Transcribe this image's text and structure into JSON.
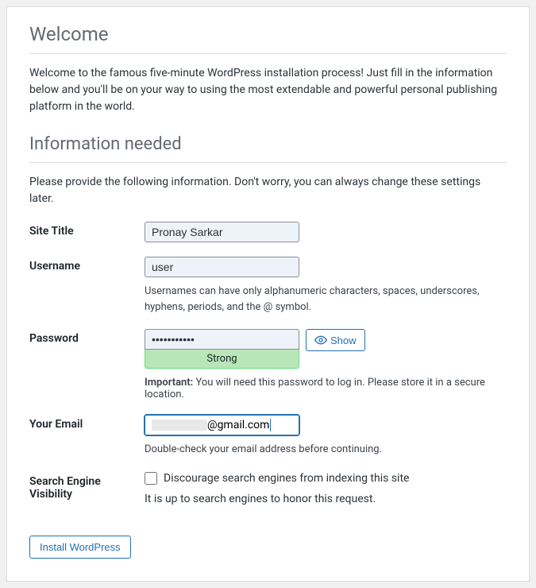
{
  "headings": {
    "welcome": "Welcome",
    "info": "Information needed"
  },
  "intro": "Welcome to the famous five-minute WordPress installation process! Just fill in the information below and you'll be on your way to using the most extendable and powerful personal publishing platform in the world.",
  "subintro": "Please provide the following information. Don't worry, you can always change these settings later.",
  "fields": {
    "site_title": {
      "label": "Site Title",
      "value": "Pronay Sarkar"
    },
    "username": {
      "label": "Username",
      "value": "user",
      "description": "Usernames can have only alphanumeric characters, spaces, underscores, hyphens, periods, and the @ symbol."
    },
    "password": {
      "label": "Password",
      "value": "•••••••••••",
      "show_button": "Show",
      "strength": "Strong",
      "important_label": "Important:",
      "important_text": " You will need this password to log in. Please store it in a secure location."
    },
    "email": {
      "label": "Your Email",
      "value_visible": "@gmail.com",
      "description": "Double-check your email address before continuing."
    },
    "search_visibility": {
      "label": "Search Engine Visibility",
      "checkbox_label": "Discourage search engines from indexing this site",
      "checked": false,
      "note": "It is up to search engines to honor this request."
    }
  },
  "submit": "Install WordPress"
}
